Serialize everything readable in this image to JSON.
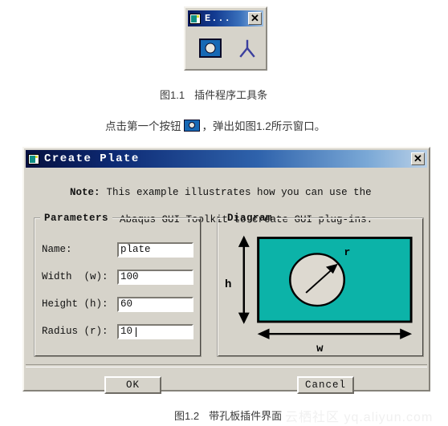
{
  "toolbar_window": {
    "title": "E...",
    "app_icon": "plugin-app-icon",
    "close_label": "✕",
    "buttons": [
      {
        "name": "create-plate-tool",
        "icon": "plate-with-hole-icon"
      },
      {
        "name": "person-tool",
        "icon": "person-icon"
      }
    ]
  },
  "captions": {
    "fig11_number": "图1.1",
    "fig11_text": "插件程序工具条",
    "fig12_number": "图1.2",
    "fig12_text": "带孔板插件界面"
  },
  "instruction": {
    "before_icon": "点击第一个按钮",
    "after_icon": "，弹出如图1.2所示窗口。"
  },
  "dialog": {
    "title": "Create Plate",
    "app_icon": "plugin-app-icon",
    "close_label": "✕",
    "note_label": "Note:",
    "note_line1": "This example illustrates how you can use the",
    "note_line2": "Abaqus GUI Toolkit to create GUI plug-ins.",
    "parameters": {
      "legend": "Parameters",
      "fields": [
        {
          "label": "Name:",
          "value": "plate",
          "cursor": false
        },
        {
          "label": "Width  (w):",
          "value": "100",
          "cursor": false
        },
        {
          "label": "Height (h):",
          "value": "60",
          "cursor": false
        },
        {
          "label": "Radius (r):",
          "value": "10",
          "cursor": true
        }
      ]
    },
    "diagram": {
      "legend": "Diagram",
      "labels": {
        "height": "h",
        "width": "w",
        "radius": "r"
      },
      "plate_color": "#0cb3a8",
      "hole_color": "#ddd9d0",
      "outline_color": "#000000"
    },
    "ok_label": "OK",
    "cancel_label": "Cancel"
  },
  "watermark": "云栖社区 yq.aliyun.com",
  "colors": {
    "dialog_face": "#d6d3ca",
    "titlebar_start": "#06103f",
    "titlebar_end": "#b9d0e7",
    "teal": "#0cb3a8",
    "tool_button_blue": "#1769b5"
  }
}
